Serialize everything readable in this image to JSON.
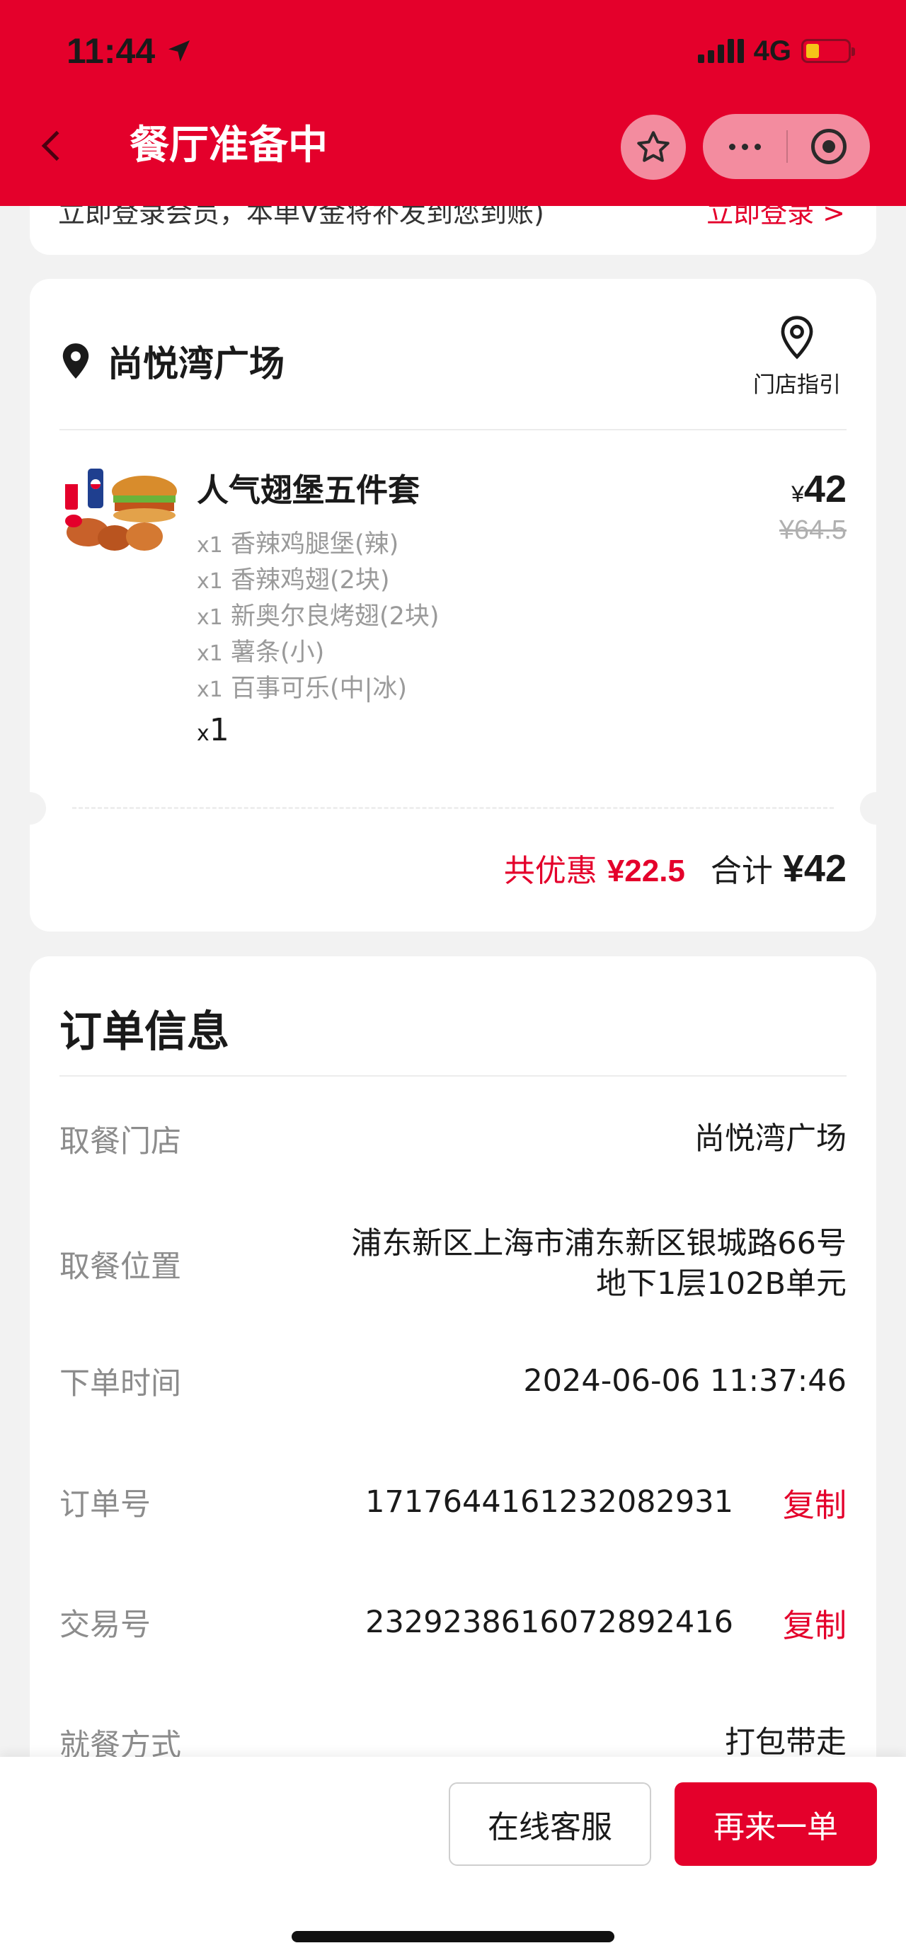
{
  "status_bar": {
    "time": "11:44",
    "network": "4G",
    "battery_color": "#f5c518"
  },
  "nav": {
    "title": "餐厅准备中"
  },
  "member_banner": {
    "text": "立即登录会员，本单V金将补发到您到账)",
    "link": "立即登录 >"
  },
  "store": {
    "name": "尚悦湾广场",
    "guide_label": "门店指引"
  },
  "order_item": {
    "name": "人气翅堡五件套",
    "components": [
      {
        "qty": "x1",
        "name": "香辣鸡腿堡(辣)"
      },
      {
        "qty": "x1",
        "name": "香辣鸡翅(2块)"
      },
      {
        "qty": "x1",
        "name": "新奥尔良烤翅(2块)"
      },
      {
        "qty": "x1",
        "name": "薯条(小)"
      },
      {
        "qty": "x1",
        "name": "百事可乐(中|冰)"
      }
    ],
    "qty_prefix": "x",
    "qty": "1",
    "currency": "¥",
    "price": "42",
    "original_price": "¥64.5"
  },
  "totals": {
    "discount_label": "共优惠",
    "discount": "¥22.5",
    "total_label": "合计",
    "total": "¥42"
  },
  "order_info": {
    "title": "订单信息",
    "rows": [
      {
        "label": "取餐门店",
        "value": "尚悦湾广场"
      },
      {
        "label": "取餐位置",
        "value_line1": "浦东新区上海市浦东新区银城路66号",
        "value_line2": "地下1层102B单元"
      },
      {
        "label": "下单时间",
        "value": "2024-06-06 11:37:46"
      },
      {
        "label": "订单号",
        "value": "1717644161232082931",
        "action": "复制"
      },
      {
        "label": "交易号",
        "value": "2329238616072892416",
        "action": "复制"
      },
      {
        "label": "就餐方式",
        "value": "打包带走"
      }
    ]
  },
  "actions": {
    "service": "在线客服",
    "reorder": "再来一单"
  },
  "colors": {
    "brand_red": "#e4002b",
    "background": "#f2f2f2"
  }
}
